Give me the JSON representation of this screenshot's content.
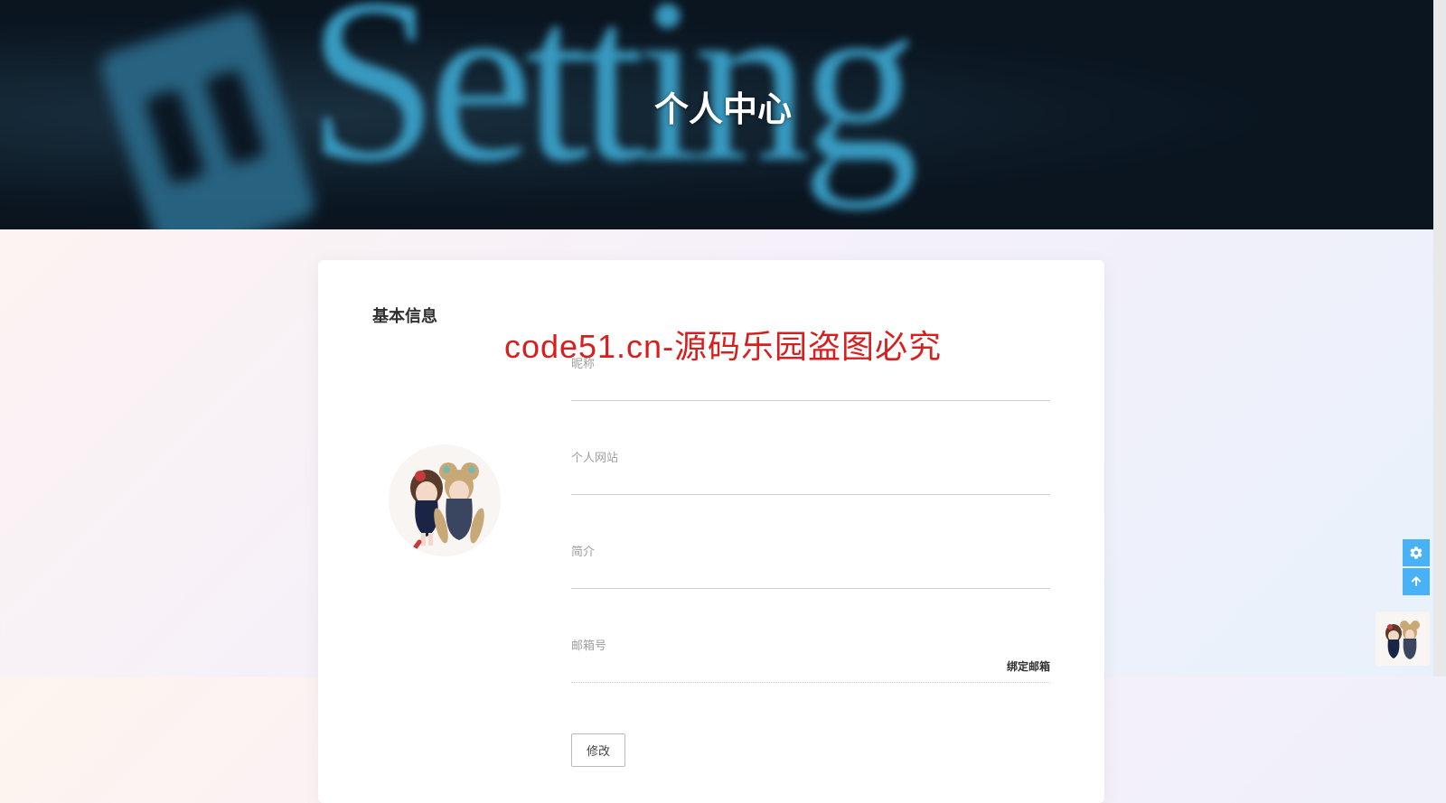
{
  "banner": {
    "title": "个人中心",
    "bg_word": "Setting"
  },
  "watermark": "code51.cn-源码乐园盗图必究",
  "card": {
    "section_title": "基本信息",
    "fields": {
      "nickname": {
        "label": "昵称",
        "value": ""
      },
      "website": {
        "label": "个人网站",
        "value": ""
      },
      "intro": {
        "label": "简介",
        "value": ""
      },
      "email": {
        "label": "邮箱号",
        "value": "",
        "action": "绑定邮箱"
      }
    },
    "submit_label": "修改"
  },
  "float": {
    "settings_icon": "gear-icon",
    "top_icon": "arrow-up-icon"
  }
}
